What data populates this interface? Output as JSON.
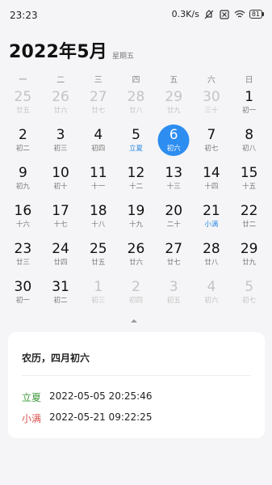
{
  "status": {
    "time": "23:23",
    "speed": "0.3K/s",
    "battery": "81",
    "icons": [
      "mute-icon",
      "sim-off-icon",
      "wifi-icon",
      "battery-icon"
    ]
  },
  "header": {
    "title": "2022年5月",
    "weekday": "星期五"
  },
  "weekdays": [
    "一",
    "二",
    "三",
    "四",
    "五",
    "六",
    "日"
  ],
  "days": [
    {
      "n": "25",
      "s": "廿五",
      "other": true
    },
    {
      "n": "26",
      "s": "廿六",
      "other": true
    },
    {
      "n": "27",
      "s": "廿七",
      "other": true
    },
    {
      "n": "28",
      "s": "廿八",
      "other": true
    },
    {
      "n": "29",
      "s": "廿九",
      "other": true
    },
    {
      "n": "30",
      "s": "三十",
      "other": true
    },
    {
      "n": "1",
      "s": "初一"
    },
    {
      "n": "2",
      "s": "初二"
    },
    {
      "n": "3",
      "s": "初三"
    },
    {
      "n": "4",
      "s": "初四"
    },
    {
      "n": "5",
      "s": "立夏",
      "term": true
    },
    {
      "n": "6",
      "s": "初六",
      "selected": true
    },
    {
      "n": "7",
      "s": "初七"
    },
    {
      "n": "8",
      "s": "初八"
    },
    {
      "n": "9",
      "s": "初九"
    },
    {
      "n": "10",
      "s": "初十"
    },
    {
      "n": "11",
      "s": "十一"
    },
    {
      "n": "12",
      "s": "十二"
    },
    {
      "n": "13",
      "s": "十三"
    },
    {
      "n": "14",
      "s": "十四"
    },
    {
      "n": "15",
      "s": "十五"
    },
    {
      "n": "16",
      "s": "十六"
    },
    {
      "n": "17",
      "s": "十七"
    },
    {
      "n": "18",
      "s": "十八"
    },
    {
      "n": "19",
      "s": "十九"
    },
    {
      "n": "20",
      "s": "二十"
    },
    {
      "n": "21",
      "s": "小满",
      "term": true
    },
    {
      "n": "22",
      "s": "廿二"
    },
    {
      "n": "23",
      "s": "廿三"
    },
    {
      "n": "24",
      "s": "廿四"
    },
    {
      "n": "25",
      "s": "廿五"
    },
    {
      "n": "26",
      "s": "廿六"
    },
    {
      "n": "27",
      "s": "廿七"
    },
    {
      "n": "28",
      "s": "廿八"
    },
    {
      "n": "29",
      "s": "廿九"
    },
    {
      "n": "30",
      "s": "初一"
    },
    {
      "n": "31",
      "s": "初二"
    },
    {
      "n": "1",
      "s": "初三",
      "other": true
    },
    {
      "n": "2",
      "s": "初四",
      "other": true
    },
    {
      "n": "3",
      "s": "初五",
      "other": true
    },
    {
      "n": "4",
      "s": "初六",
      "other": true
    },
    {
      "n": "5",
      "s": "初七",
      "other": true
    }
  ],
  "card": {
    "lunar": "农历，四月初六",
    "terms": [
      {
        "name": "立夏",
        "time": "2022-05-05 20:25:46",
        "color": "#3f9a3f"
      },
      {
        "name": "小满",
        "time": "2022-05-21 09:22:25",
        "color": "#d9534f"
      }
    ]
  },
  "colors": {
    "accent": "#2d8df0",
    "term_text": "#2a88e0"
  }
}
